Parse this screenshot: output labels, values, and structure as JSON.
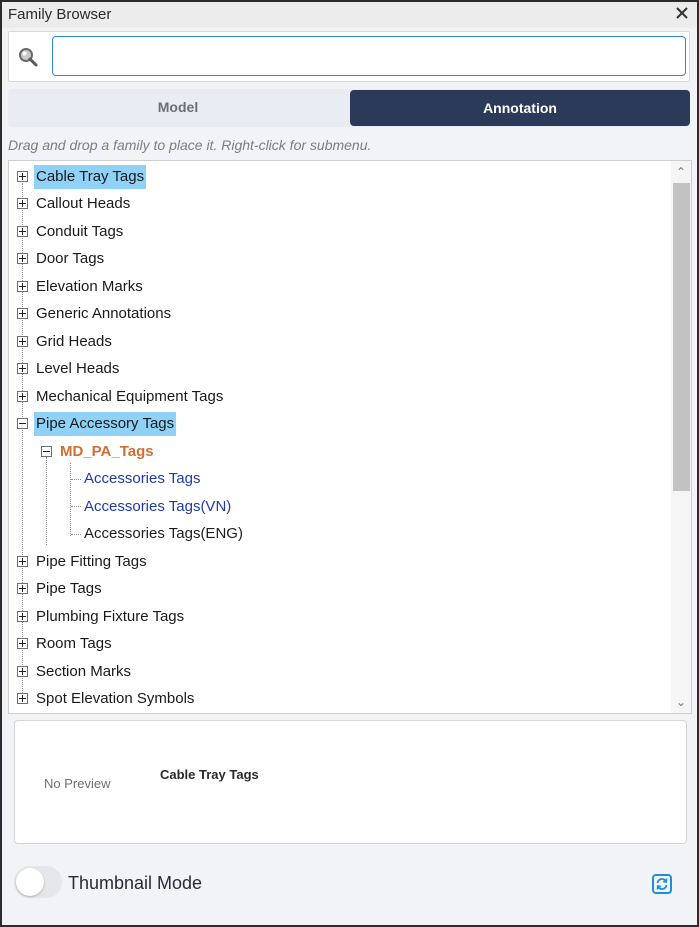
{
  "window": {
    "title": "Family Browser"
  },
  "search": {
    "value": "",
    "placeholder": ""
  },
  "tabs": [
    {
      "label": "Model",
      "active": false
    },
    {
      "label": "Annotation",
      "active": true
    }
  ],
  "hint": "Drag and drop a family to place it. Right-click for submenu.",
  "tree": {
    "categories_top": [
      {
        "label": "Cable Tray Tags",
        "selected": true
      },
      {
        "label": "Callout Heads"
      },
      {
        "label": "Conduit Tags"
      },
      {
        "label": "Door Tags"
      },
      {
        "label": "Elevation Marks"
      },
      {
        "label": "Generic Annotations"
      },
      {
        "label": "Grid Heads"
      },
      {
        "label": "Level Heads"
      },
      {
        "label": "Mechanical Equipment Tags"
      }
    ],
    "expanded": {
      "label": "Pipe Accessory Tags",
      "subgroup": "MD_PA_Tags",
      "families": [
        "Accessories Tags",
        "Accessories Tags(VN)",
        "Accessories Tags(ENG)"
      ]
    },
    "categories_bottom": [
      {
        "label": "Pipe Fitting Tags"
      },
      {
        "label": "Pipe Tags"
      },
      {
        "label": "Plumbing Fixture Tags"
      },
      {
        "label": "Room Tags"
      },
      {
        "label": "Section Marks"
      },
      {
        "label": "Spot Elevation Symbols"
      }
    ]
  },
  "preview": {
    "no_preview": "No Preview",
    "name": "Cable Tray Tags"
  },
  "footer": {
    "thumbnail_label": "Thumbnail Mode",
    "thumbnail_on": false
  },
  "colors": {
    "accent": "#2a3a58",
    "selection": "#8fd1f7",
    "subgroup": "#d06f36",
    "family_link": "#1f3aa8",
    "refresh": "#1e8fd6"
  },
  "icons": [
    "close-icon",
    "search-icon",
    "refresh-icon"
  ]
}
